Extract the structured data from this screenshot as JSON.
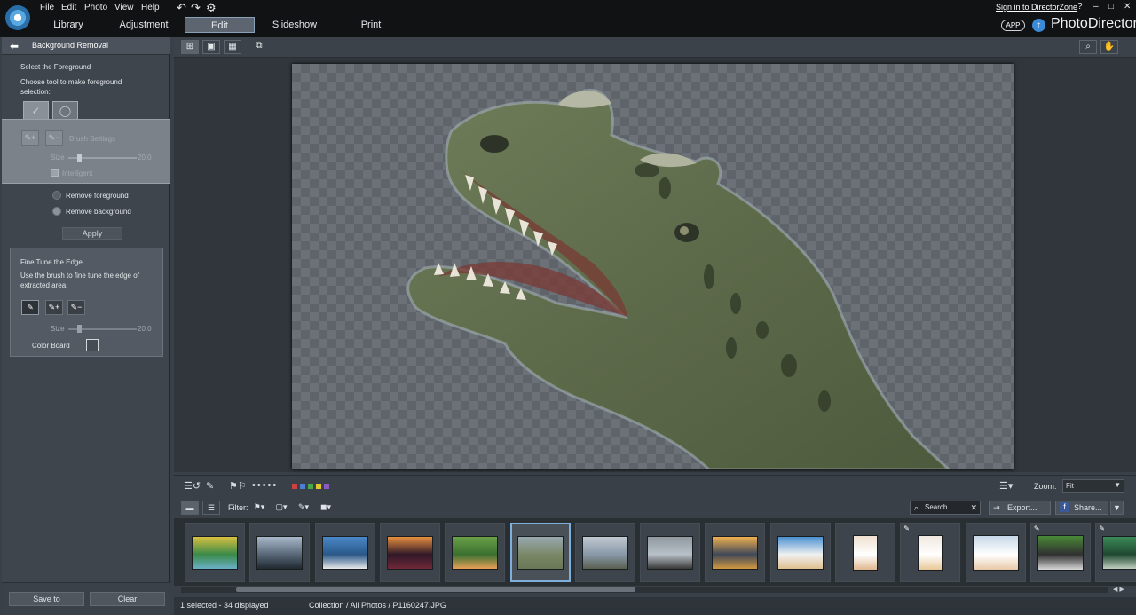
{
  "menu": [
    "File",
    "Edit",
    "Photo",
    "View",
    "Help"
  ],
  "toolbar_icons": [
    "undo-icon",
    "redo-icon",
    "settings-icon"
  ],
  "modes": [
    "Library",
    "Adjustment",
    "Edit",
    "Slideshow",
    "Print"
  ],
  "active_mode": "Edit",
  "signin": "Sign in to DirectorZone",
  "window_buttons": [
    "?",
    "–",
    "□",
    "✕"
  ],
  "app_badge": "APP",
  "brand": "PhotoDirector",
  "panel": {
    "title": "Background Removal",
    "select_fg": "Select the Foreground",
    "choose_tool": "Choose tool to make foreground selection:",
    "brush_settings": "Brush Settings",
    "size_label": "Size",
    "size_value": "20.0",
    "intelligent": "Intelligent",
    "remove_fg": "Remove foreground",
    "remove_bg": "Remove background",
    "apply": "Apply",
    "fine_title": "Fine Tune the Edge",
    "fine_desc": "Use the brush to fine tune the edge of extracted area.",
    "fine_size_label": "Size",
    "fine_size_value": "20.0",
    "color_board": "Color Board",
    "save_to": "Save to",
    "clear": "Clear"
  },
  "zoom": {
    "label": "Zoom:",
    "value": "Fit"
  },
  "filter": {
    "label": "Filter:"
  },
  "color_labels": [
    "#d04040",
    "#4d7fd0",
    "#4aa84a",
    "#e2c830",
    "#8a5bc0"
  ],
  "search": {
    "placeholder": "Search"
  },
  "export": "Export...",
  "share": "Share...",
  "thumbnails": [
    {
      "colors": [
        "#d8c040",
        "#6ab0c8",
        "#3a8a48"
      ],
      "selected": false,
      "edited": false
    },
    {
      "colors": [
        "#a8b8c8",
        "#202830",
        "#586878"
      ],
      "selected": false,
      "edited": false
    },
    {
      "colors": [
        "#4a88c8",
        "#e8e8e8",
        "#2a5888"
      ],
      "selected": false,
      "edited": false
    },
    {
      "colors": [
        "#e89040",
        "#702838",
        "#301828"
      ],
      "selected": false,
      "edited": false
    },
    {
      "colors": [
        "#6aa048",
        "#e8a058",
        "#3a7030"
      ],
      "selected": false,
      "edited": false
    },
    {
      "colors": [
        "#98a8b0",
        "#6a7858",
        "#7a8868"
      ],
      "selected": true,
      "edited": false
    },
    {
      "colors": [
        "#c0c8d0",
        "#5a6050",
        "#8898a8"
      ],
      "selected": false,
      "edited": false
    },
    {
      "colors": [
        "#909aa0",
        "#383838",
        "#b8c0c8"
      ],
      "selected": false,
      "edited": false
    },
    {
      "colors": [
        "#f0b050",
        "#d09840",
        "#404858"
      ],
      "selected": false,
      "edited": false
    },
    {
      "colors": [
        "#4a90d0",
        "#e0c090",
        "#f0f0f0"
      ],
      "selected": false,
      "edited": false
    },
    {
      "colors": [
        "#f0e0d0",
        "#e0b890",
        "#ffffff"
      ],
      "selected": false,
      "edited": false
    },
    {
      "colors": [
        "#f0e8e0",
        "#e8c898",
        "#ffffff"
      ],
      "selected": false,
      "edited": true
    },
    {
      "colors": [
        "#c8d8e8",
        "#e8c8a8",
        "#ffffff"
      ],
      "selected": false,
      "edited": false
    },
    {
      "colors": [
        "#4a8a38",
        "#d8d8d8",
        "#303030"
      ],
      "selected": false,
      "edited": true
    },
    {
      "colors": [
        "#3a8a58",
        "#c0d0c0",
        "#204830"
      ],
      "selected": false,
      "edited": true
    }
  ],
  "status": {
    "count": "1 selected - 34 displayed",
    "path": "Collection / All Photos / P1160247.JPG"
  }
}
